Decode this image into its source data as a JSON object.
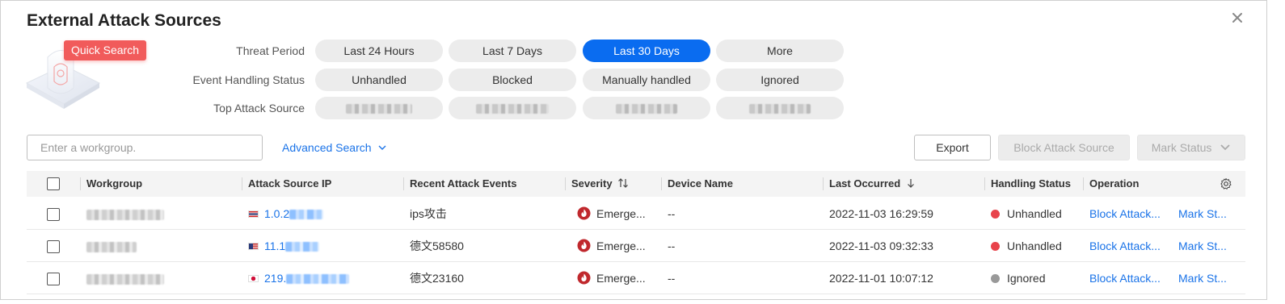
{
  "dialog": {
    "title": "External Attack Sources"
  },
  "quick_search": {
    "label": "Quick Search"
  },
  "filters": {
    "threat_period": {
      "label": "Threat Period",
      "options": [
        "Last 24 Hours",
        "Last 7 Days",
        "Last 30 Days",
        "More"
      ],
      "selected": "Last 30 Days"
    },
    "event_handling_status": {
      "label": "Event Handling Status",
      "options": [
        "Unhandled",
        "Blocked",
        "Manually handled",
        "Ignored"
      ]
    },
    "top_attack_source": {
      "label": "Top Attack Source"
    }
  },
  "toolbar": {
    "workgroup_placeholder": "Enter a workgroup.",
    "advanced_search": "Advanced Search",
    "export": "Export",
    "block_attack_source": "Block Attack Source",
    "mark_status": "Mark Status"
  },
  "table": {
    "columns": [
      "Workgroup",
      "Attack Source IP",
      "Recent Attack Events",
      "Severity",
      "Device Name",
      "Last Occurred",
      "Handling Status",
      "Operation"
    ],
    "rows": [
      {
        "ip_prefix": "1.0.2",
        "flag": "thailand-flag",
        "event": "ips攻击",
        "severity": "Emerge...",
        "device": "--",
        "last_occurred": "2022-11-03 16:29:59",
        "status": "Unhandled",
        "status_color": "#e8434b",
        "op1": "Block Attack...",
        "op2": "Mark St..."
      },
      {
        "ip_prefix": "11.1",
        "flag": "usa-flag",
        "event": "德文58580",
        "severity": "Emerge...",
        "device": "--",
        "last_occurred": "2022-11-03 09:32:33",
        "status": "Unhandled",
        "status_color": "#e8434b",
        "op1": "Block Attack...",
        "op2": "Mark St..."
      },
      {
        "ip_prefix": "219.",
        "flag": "japan-flag",
        "event": "德文23160",
        "severity": "Emerge...",
        "device": "--",
        "last_occurred": "2022-11-01 10:07:12",
        "status": "Ignored",
        "status_color": "#999999",
        "op1": "Block Attack...",
        "op2": "Mark St..."
      }
    ]
  },
  "colors": {
    "accent": "#0a6cf0",
    "link": "#1a73e8",
    "danger": "#e8434b",
    "severity_icon": "#c0282d"
  },
  "icons": {
    "close": "close-icon",
    "chevron": "chevron-down-icon",
    "sort": "sort-icon",
    "sort_desc": "arrow-down-icon",
    "settings": "gear-icon",
    "severity": "fire-icon"
  }
}
